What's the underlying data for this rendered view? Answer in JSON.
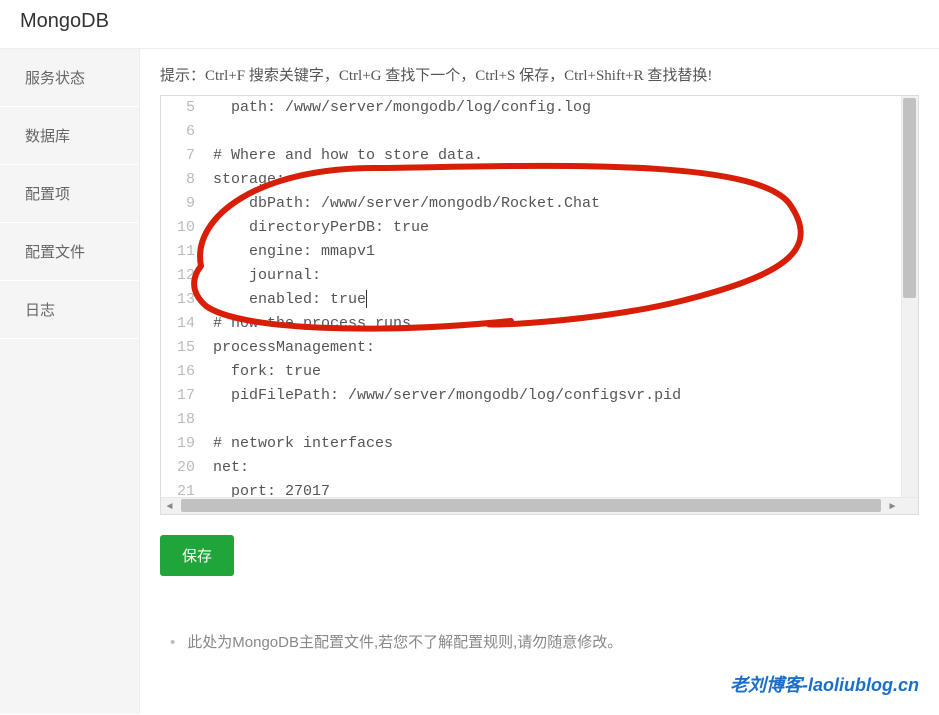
{
  "header": {
    "title": "MongoDB"
  },
  "sidebar": {
    "items": [
      {
        "label": "服务状态"
      },
      {
        "label": "数据库"
      },
      {
        "label": "配置项"
      },
      {
        "label": "配置文件"
      },
      {
        "label": "日志"
      }
    ]
  },
  "content": {
    "hint": "提示：Ctrl+F 搜索关键字，Ctrl+G 查找下一个，Ctrl+S 保存，Ctrl+Shift+R 查找替换!",
    "code_lines": [
      {
        "num": 5,
        "text": "  path: /www/server/mongodb/log/config.log"
      },
      {
        "num": 6,
        "text": ""
      },
      {
        "num": 7,
        "text": "# Where and how to store data."
      },
      {
        "num": 8,
        "text": "storage:"
      },
      {
        "num": 9,
        "text": "    dbPath: /www/server/mongodb/Rocket.Chat"
      },
      {
        "num": 10,
        "text": "    directoryPerDB: true"
      },
      {
        "num": 11,
        "text": "    engine: mmapv1"
      },
      {
        "num": 12,
        "text": "    journal:"
      },
      {
        "num": 13,
        "text": "    enabled: true"
      },
      {
        "num": 14,
        "text": "# how the process runs"
      },
      {
        "num": 15,
        "text": "processManagement:"
      },
      {
        "num": 16,
        "text": "  fork: true"
      },
      {
        "num": 17,
        "text": "  pidFilePath: /www/server/mongodb/log/configsvr.pid"
      },
      {
        "num": 18,
        "text": ""
      },
      {
        "num": 19,
        "text": "# network interfaces"
      },
      {
        "num": 20,
        "text": "net:"
      },
      {
        "num": 21,
        "text": "  port: 27017"
      }
    ],
    "save_label": "保存",
    "footer_note": "此处为MongoDB主配置文件,若您不了解配置规则,请勿随意修改。"
  },
  "watermark": "老刘博客-laoliublog.cn"
}
